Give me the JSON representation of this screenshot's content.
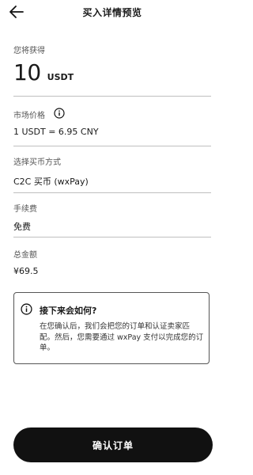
{
  "header": {
    "title": "买入详情预览",
    "back_icon": "arrow-left-icon"
  },
  "receive": {
    "label": "您将获得",
    "amount": "10",
    "unit": "USDT"
  },
  "market_price": {
    "label": "市场价格",
    "value": "1 USDT = 6.95 CNY",
    "info_icon": "info-icon"
  },
  "payment_method": {
    "label": "选择买币方式",
    "value": "C2C 买币 (wxPay)"
  },
  "fee": {
    "label": "手续费",
    "value": "免费"
  },
  "total": {
    "label": "总金额",
    "value": "¥69.5"
  },
  "notice": {
    "icon": "info-icon",
    "title": "接下来会如何?",
    "text": "在您确认后，我们会把您的订单和认证卖家匹配。然后，您需要通过 wxPay 支付以完成您的订单。"
  },
  "confirm_button": {
    "label": "确认订单"
  }
}
